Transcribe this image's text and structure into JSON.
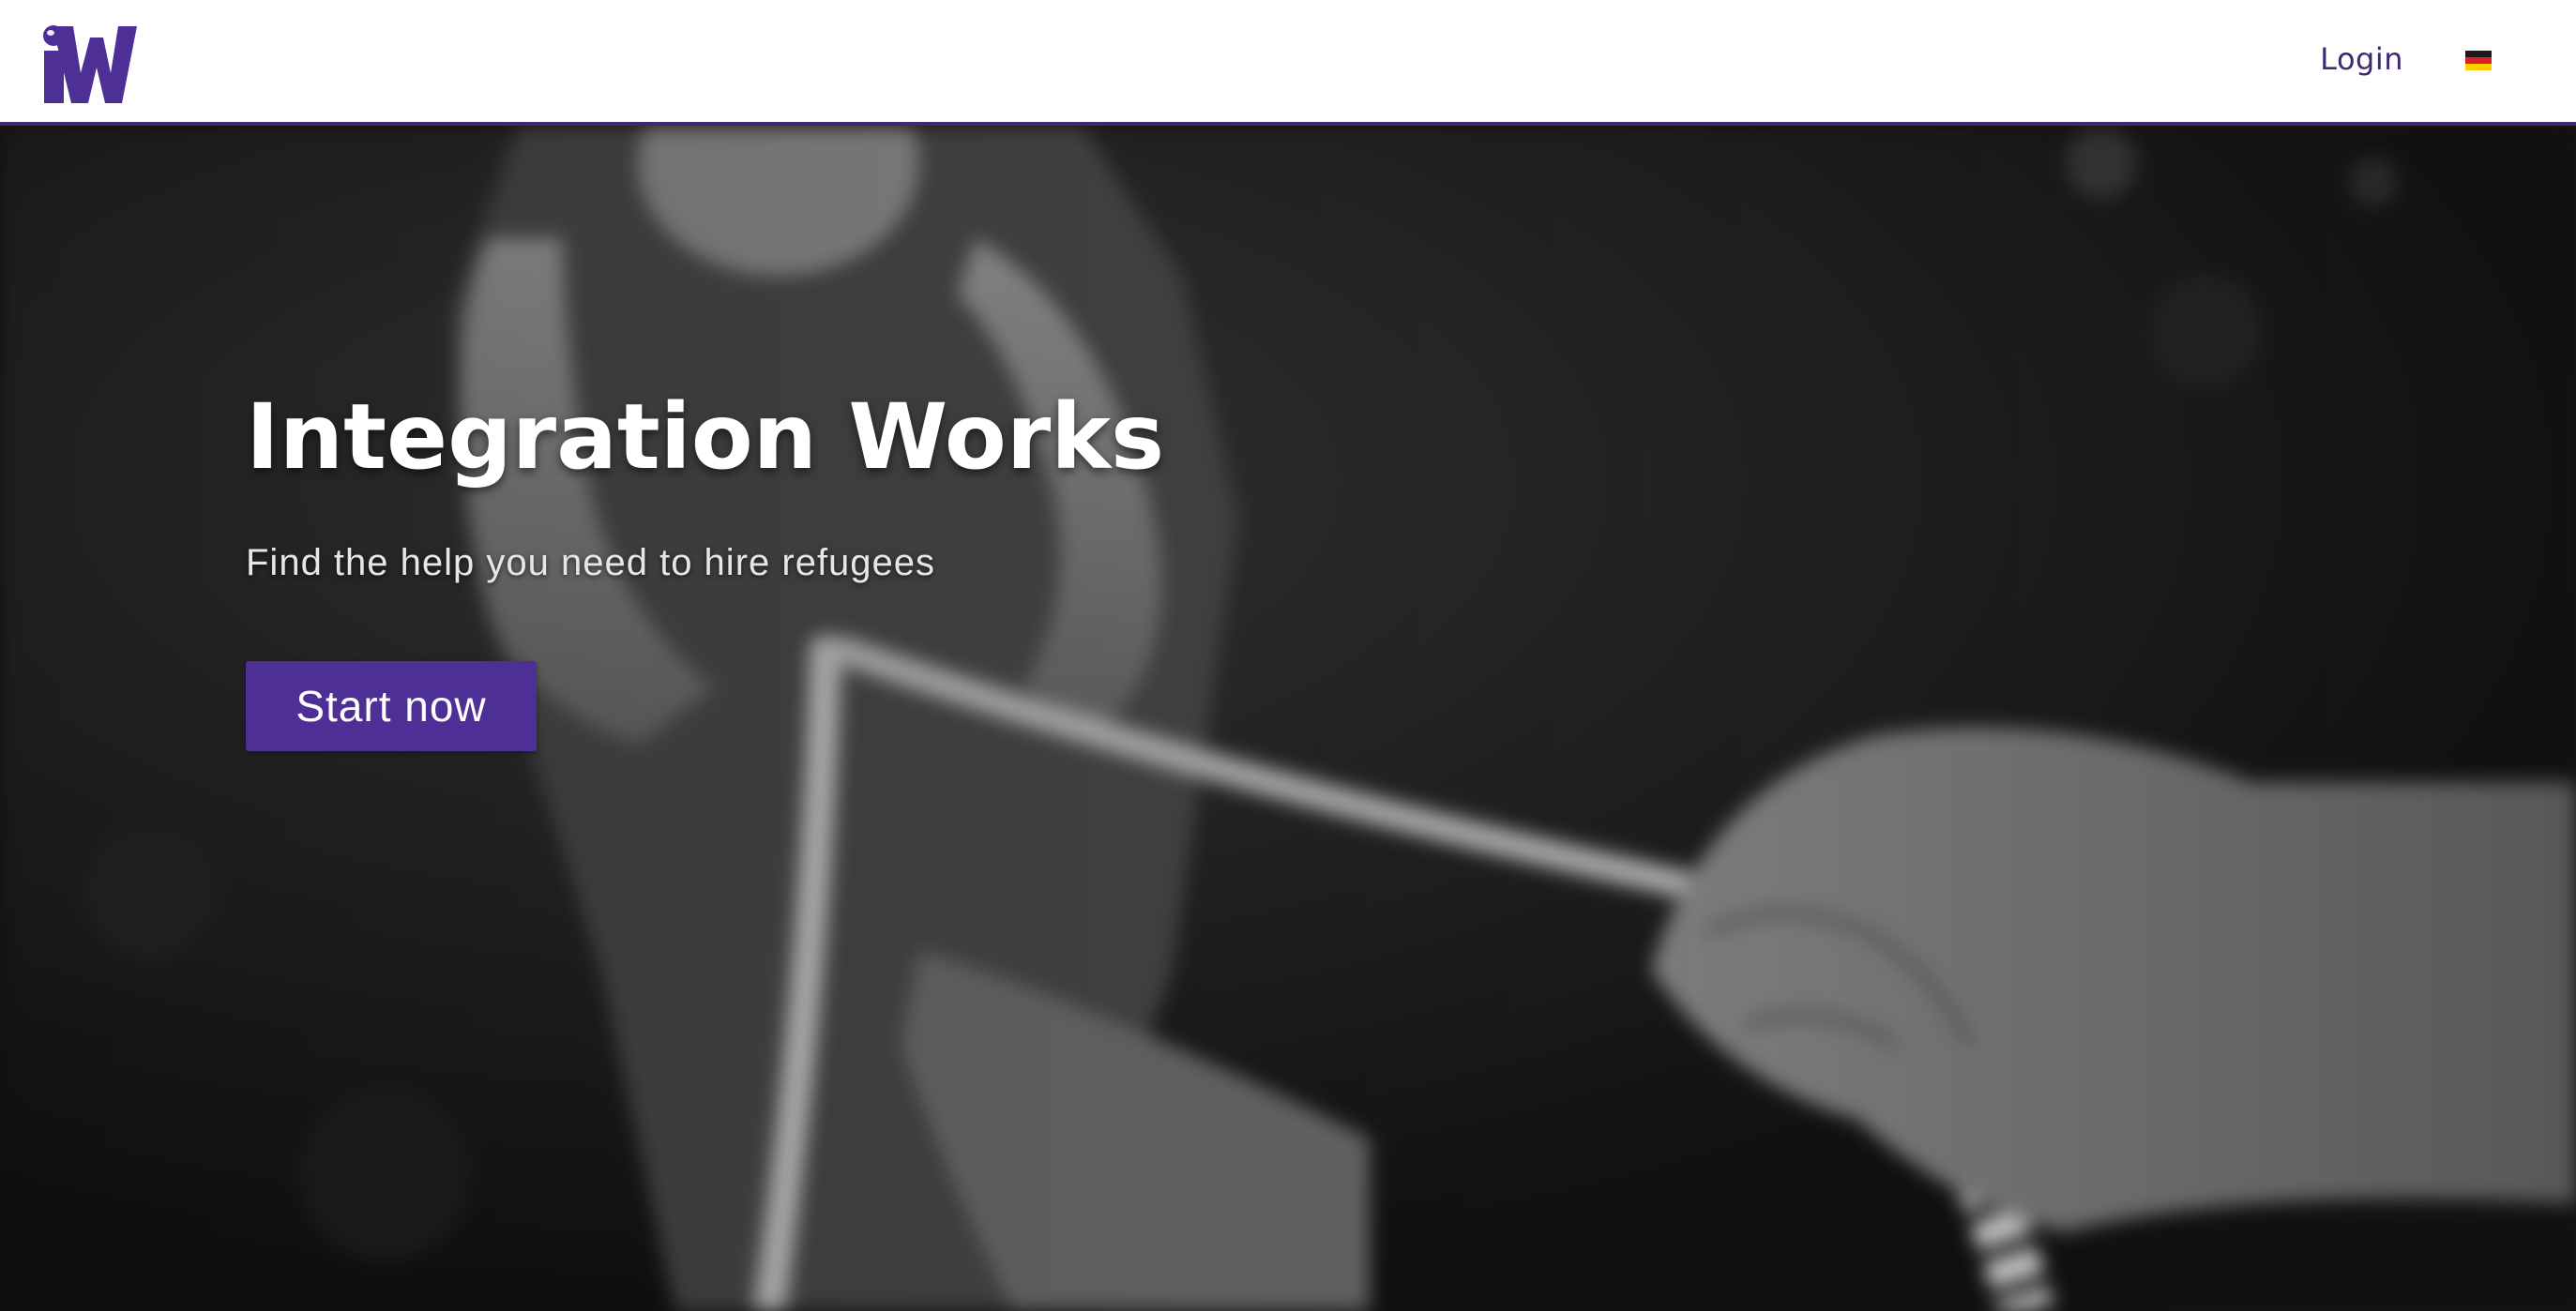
{
  "header": {
    "brand_color": "#4e2f96",
    "logo_icon": "iw-logo-icon",
    "login_label": "Login",
    "language_icon": "german-flag-icon"
  },
  "hero": {
    "title": "Integration Works",
    "subtitle": "Find the help you need to hire refugees",
    "cta_label": "Start now",
    "cta_color": "#4e2f96",
    "background_image": "blurred black-and-white photo of two people pulling a rope"
  }
}
